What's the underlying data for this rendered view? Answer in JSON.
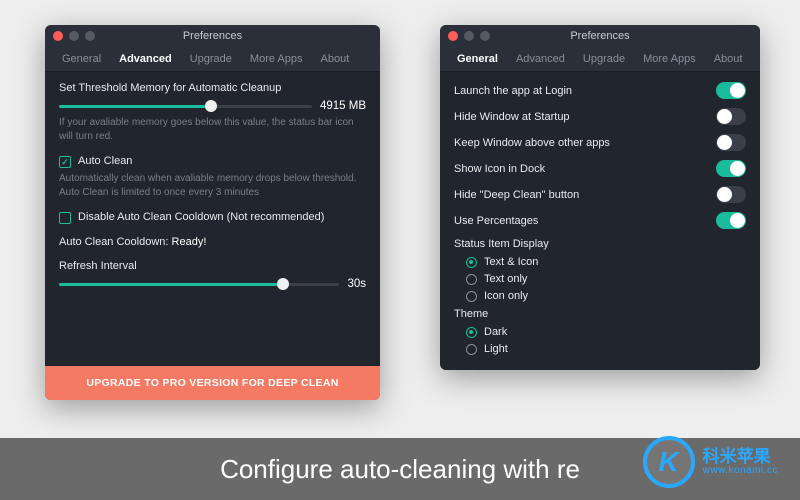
{
  "left": {
    "title": "Preferences",
    "tabs": [
      "General",
      "Advanced",
      "Upgrade",
      "More Apps",
      "About"
    ],
    "active_tab": "Advanced",
    "threshold": {
      "label": "Set Threshold Memory for Automatic Cleanup",
      "value_text": "4915 MB",
      "fill_pct": 60,
      "hint": "If your avaliable memory goes below this value, the status bar icon will turn red."
    },
    "auto_clean": {
      "checked": true,
      "label": "Auto Clean",
      "hint": "Automatically clean when avaliable memory drops below threshold. Auto Clean is limited to once every 3 minutes"
    },
    "disable_cooldown": {
      "checked": false,
      "label": "Disable Auto Clean Cooldown (Not recommended)"
    },
    "cooldown_status": {
      "label": "Auto Clean Cooldown: ",
      "value": "Ready!"
    },
    "refresh": {
      "label": "Refresh Interval",
      "value_text": "30s",
      "fill_pct": 80
    },
    "upgrade_text": "UPGRADE TO PRO VERSION FOR DEEP CLEAN"
  },
  "right": {
    "title": "Preferences",
    "tabs": [
      "General",
      "Advanced",
      "Upgrade",
      "More Apps",
      "About"
    ],
    "active_tab": "General",
    "toggles": [
      {
        "label": "Launch the app at Login",
        "on": true
      },
      {
        "label": "Hide Window at Startup",
        "on": false
      },
      {
        "label": "Keep Window above other apps",
        "on": false
      },
      {
        "label": "Show Icon in Dock",
        "on": true
      },
      {
        "label": "Hide \"Deep Clean\" button",
        "on": false
      },
      {
        "label": "Use Percentages",
        "on": true
      }
    ],
    "status_display": {
      "label": "Status Item Display",
      "options": [
        "Text & Icon",
        "Text only",
        "Icon only"
      ],
      "selected": "Text & Icon"
    },
    "theme": {
      "label": "Theme",
      "options": [
        "Dark",
        "Light"
      ],
      "selected": "Dark"
    }
  },
  "caption": "Configure auto-cleaning with re",
  "watermark": {
    "cn": "科米苹果",
    "url": "www.konami.cc",
    "k": "K"
  }
}
